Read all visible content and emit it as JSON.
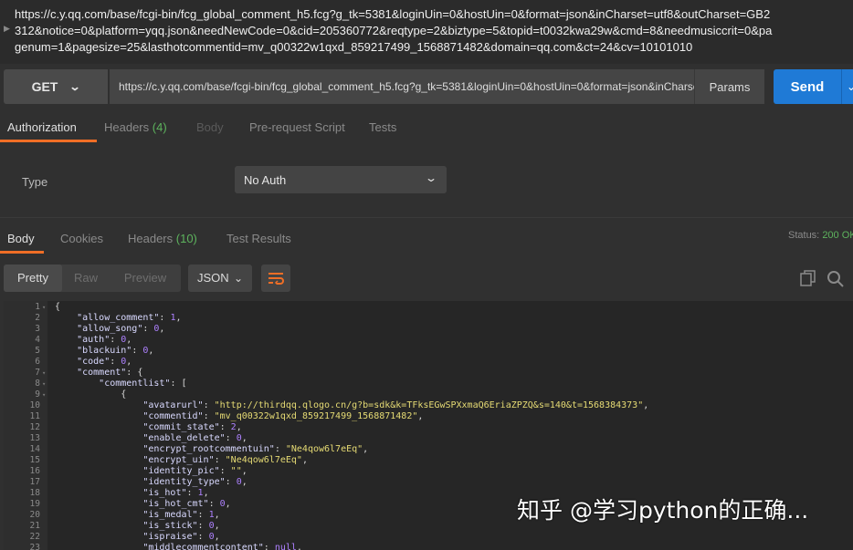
{
  "url_header": {
    "lines": [
      "https://c.y.qq.com/base/fcgi-bin/fcg_global_comment_h5.fcg?g_tk=5381&loginUin=0&hostUin=0&format=json&inCharset=utf8&outCharset=GB2",
      "312&notice=0&platform=yqq.json&needNewCode=0&cid=205360772&reqtype=2&biztype=5&topid=t0032kwa29w&cmd=8&needmusiccrit=0&pa",
      "genum=1&pagesize=25&lasthotcommentid=mv_q00322w1qxd_859217499_1568871482&domain=qq.com&ct=24&cv=10101010"
    ]
  },
  "request": {
    "method": "GET",
    "url": "https://c.y.qq.com/base/fcgi-bin/fcg_global_comment_h5.fcg?g_tk=5381&loginUin=0&hostUin=0&format=json&inCharset=utf8&outCharset=GB2312&notice=0&platform=yqq.json",
    "params_label": "Params",
    "send_label": "Send"
  },
  "request_tabs": [
    {
      "label": "Authorization",
      "count": ""
    },
    {
      "label": "Headers",
      "count": "(4)"
    },
    {
      "label": "Body",
      "count": ""
    },
    {
      "label": "Pre-request Script",
      "count": ""
    },
    {
      "label": "Tests",
      "count": ""
    }
  ],
  "auth": {
    "type_label": "Type",
    "type_value": "No Auth"
  },
  "response_tabs": [
    {
      "label": "Body",
      "count": ""
    },
    {
      "label": "Cookies",
      "count": ""
    },
    {
      "label": "Headers",
      "count": "(10)"
    },
    {
      "label": "Test Results",
      "count": ""
    }
  ],
  "status": {
    "label": "Status:",
    "value": "200 OK"
  },
  "view_modes": [
    "Pretty",
    "Raw",
    "Preview"
  ],
  "format": "JSON",
  "icons": {
    "wrap": "wrap-lines-icon",
    "copy": "copy-icon",
    "search": "search-icon",
    "dropdown": "chevron-down-icon",
    "fold": "fold-arrow-icon"
  },
  "colors": {
    "accent": "#f06e26",
    "send": "#1f7ad6",
    "status_ok": "#5db35d",
    "string": "#e6db74",
    "number": "#ae81ff"
  },
  "code_lines": [
    {
      "n": "1",
      "fold": true,
      "t": "{"
    },
    {
      "n": "2",
      "t": "    \"allow_comment\": 1,"
    },
    {
      "n": "3",
      "t": "    \"allow_song\": 0,"
    },
    {
      "n": "4",
      "t": "    \"auth\": 0,"
    },
    {
      "n": "5",
      "t": "    \"blackuin\": 0,"
    },
    {
      "n": "6",
      "t": "    \"code\": 0,"
    },
    {
      "n": "7",
      "fold": true,
      "t": "    \"comment\": {"
    },
    {
      "n": "8",
      "fold": true,
      "t": "        \"commentlist\": ["
    },
    {
      "n": "9",
      "fold": true,
      "t": "            {"
    },
    {
      "n": "10",
      "t": "                \"avatarurl\": \"http://thirdqq.qlogo.cn/g?b=sdk&k=TFksEGwSPXxmaQ6EriaZPZQ&s=140&t=1568384373\","
    },
    {
      "n": "11",
      "t": "                \"commentid\": \"mv_q00322w1qxd_859217499_1568871482\","
    },
    {
      "n": "12",
      "t": "                \"commit_state\": 2,"
    },
    {
      "n": "13",
      "t": "                \"enable_delete\": 0,"
    },
    {
      "n": "14",
      "t": "                \"encrypt_rootcommentuin\": \"Ne4qow6l7eEq\","
    },
    {
      "n": "15",
      "t": "                \"encrypt_uin\": \"Ne4qow6l7eEq\","
    },
    {
      "n": "16",
      "t": "                \"identity_pic\": \"\","
    },
    {
      "n": "17",
      "t": "                \"identity_type\": 0,"
    },
    {
      "n": "18",
      "t": "                \"is_hot\": 1,"
    },
    {
      "n": "19",
      "t": "                \"is_hot_cmt\": 0,"
    },
    {
      "n": "20",
      "t": "                \"is_medal\": 1,"
    },
    {
      "n": "21",
      "t": "                \"is_stick\": 0,"
    },
    {
      "n": "22",
      "t": "                \"ispraise\": 0,"
    },
    {
      "n": "23",
      "t": "                \"middlecommentcontent\": null,"
    }
  ],
  "watermark": "知乎 @学习python的正确..."
}
